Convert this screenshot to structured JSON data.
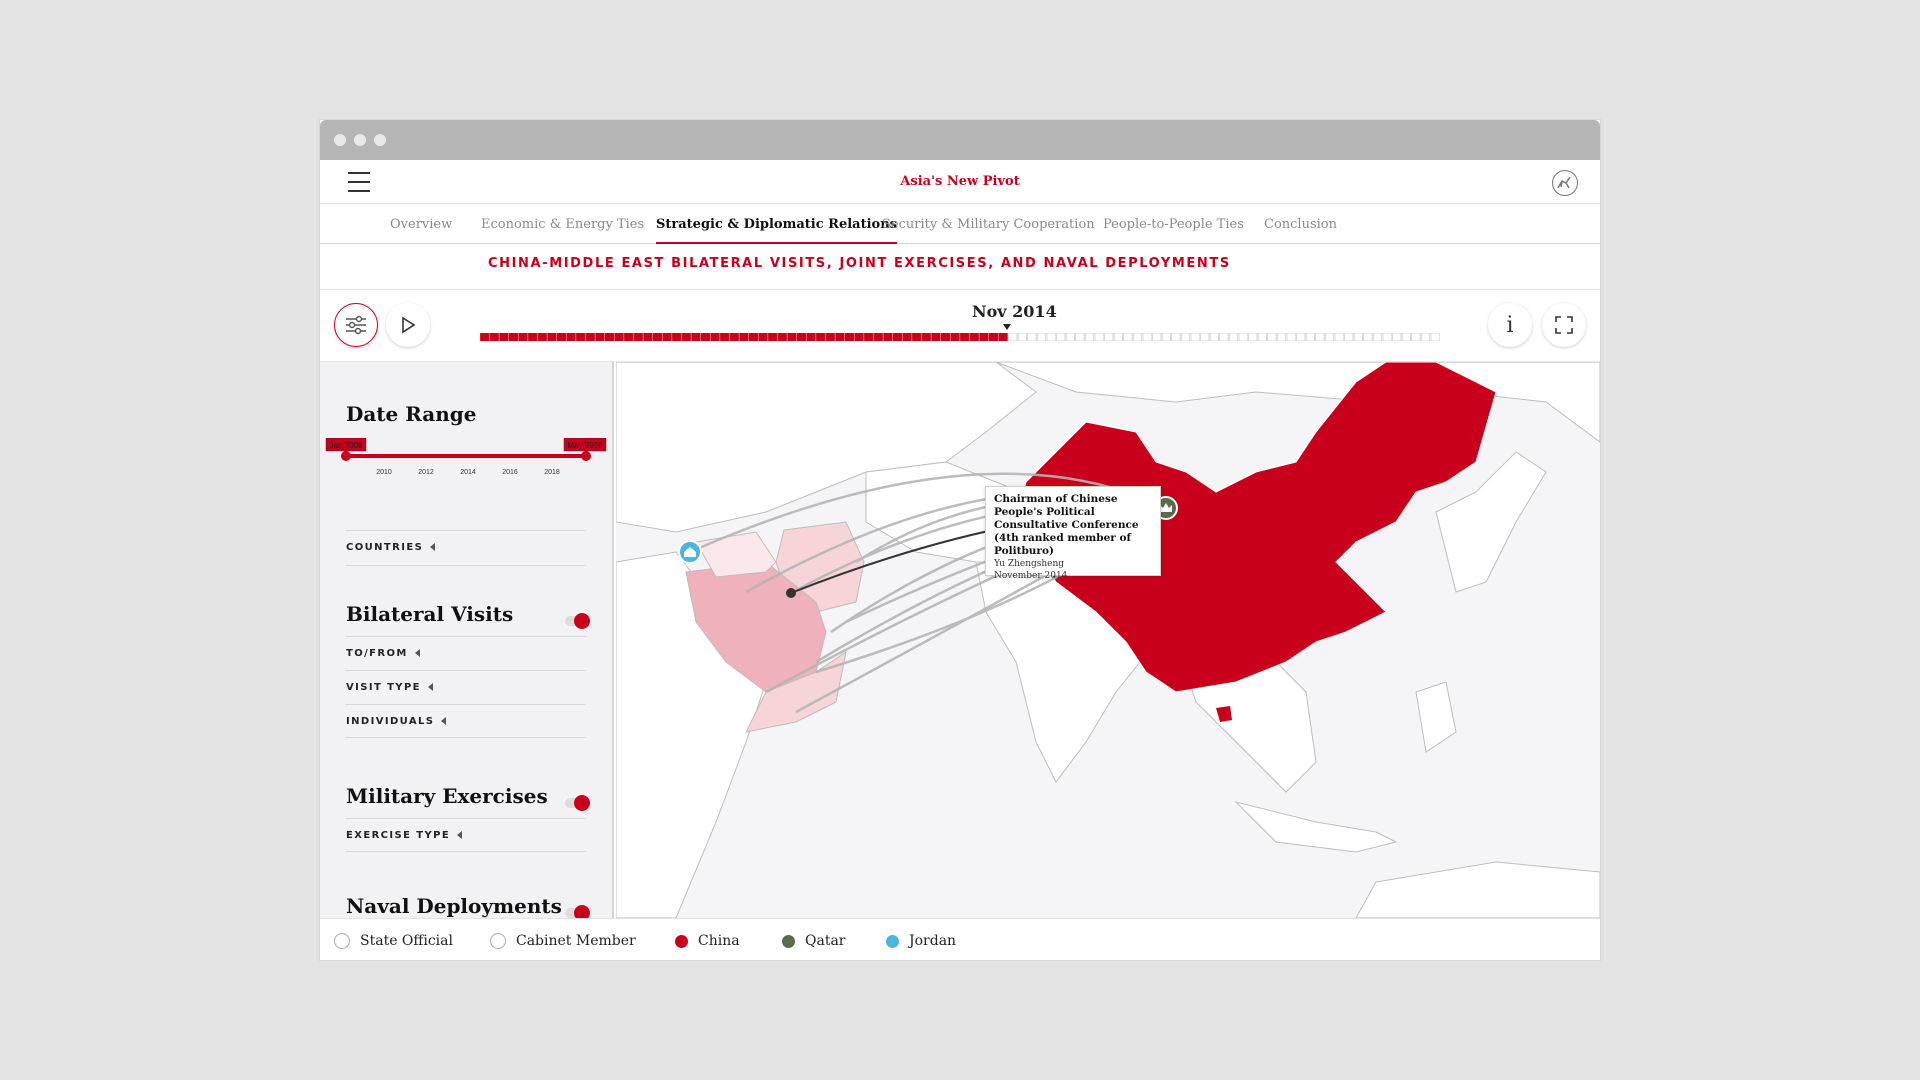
{
  "header": {
    "title": "Asia's New Pivot"
  },
  "tabs": [
    {
      "label": "Overview"
    },
    {
      "label": "Economic & Energy Ties"
    },
    {
      "label": "Strategic & Diplomatic Relations"
    },
    {
      "label": "Security & Military Cooperation"
    },
    {
      "label": "People-to-People Ties"
    },
    {
      "label": "Conclusion"
    }
  ],
  "active_tab": "Strategic & Diplomatic Relations",
  "section": {
    "title": "CHINA-MIDDLE EAST BILATERAL VISITS, JOINT EXERCISES, AND NAVAL DEPLOYMENTS"
  },
  "timeline": {
    "current": "Nov 2014",
    "progress": 0.55,
    "segments": 55
  },
  "sidebar": {
    "date_range": {
      "heading": "Date Range",
      "start": "Jan 2008",
      "end": "May 2019",
      "ticks": [
        "2010",
        "2012",
        "2014",
        "2016",
        "2018"
      ]
    },
    "countries_label": "COUNTRIES",
    "bilateral": {
      "heading": "Bilateral Visits",
      "enabled": true,
      "filters": [
        "TO/FROM",
        "VISIT TYPE",
        "INDIVIDUALS"
      ]
    },
    "military": {
      "heading": "Military Exercises",
      "enabled": true,
      "filters": [
        "EXERCISE TYPE"
      ]
    },
    "naval": {
      "heading": "Naval Deployments",
      "enabled": true
    }
  },
  "tooltip": {
    "title": "Chairman of Chinese People's Political Consultative Conference (4th ranked member of Politburo)",
    "name": "Yu Zhengsheng",
    "date": "November 2014"
  },
  "legend": [
    {
      "label": "State Official",
      "icon": "crown-icon"
    },
    {
      "label": "Cabinet Member",
      "icon": "building-icon"
    },
    {
      "label": "China",
      "color": "#c9001b"
    },
    {
      "label": "Qatar",
      "color": "#5c6b4a"
    },
    {
      "label": "Jordan",
      "color": "#4cb3e3"
    }
  ],
  "colors": {
    "accent": "#c9001b",
    "china": "#c9001b",
    "qatar": "#5c6b4a",
    "jordan": "#4cb3e3",
    "arc": "#b5b5b5"
  }
}
